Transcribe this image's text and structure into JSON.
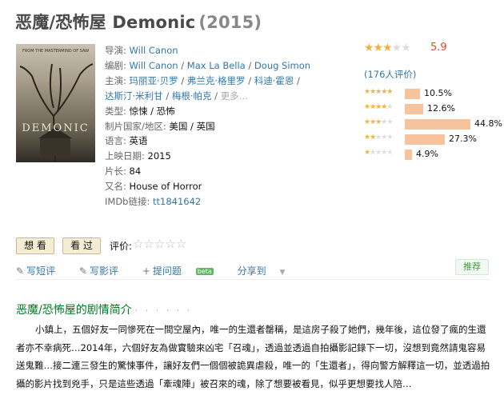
{
  "title": {
    "name": "恶魔/恐怖屋 Demonic",
    "year": "(2015)"
  },
  "poster": {
    "text": "DEMONIC",
    "tagline": "FROM THE MASTERMIND OF SAW"
  },
  "info": {
    "director_label": "导演:",
    "director": "Will Canon",
    "writer_label": "编剧:",
    "writers": [
      "Will Canon",
      "Max La Bella",
      "Doug Simon"
    ],
    "cast_label": "主演:",
    "cast": [
      "玛丽亚·贝罗",
      "弗兰克·格里罗",
      "科迪·霍恩",
      "达斯汀·米利甘",
      "梅根·帕克"
    ],
    "more": "更多...",
    "genre_label": "类型:",
    "genre": "惊悚 / 恐怖",
    "country_label": "制片国家/地区:",
    "country": "美国 / 英国",
    "language_label": "语言:",
    "language": "英语",
    "release_label": "上映日期:",
    "release": "2015",
    "runtime_label": "片长:",
    "runtime": "84",
    "aka_label": "又名:",
    "aka": "House of Horror",
    "imdb_label": "IMDb链接:",
    "imdb": "tt1841642"
  },
  "rating": {
    "score": "5.9",
    "score_value": 5.9,
    "votes": "(176人评价)",
    "distribution": [
      {
        "stars": 5,
        "percent": "10.5%",
        "value": 10.5
      },
      {
        "stars": 4,
        "percent": "12.6%",
        "value": 12.6
      },
      {
        "stars": 3,
        "percent": "44.8%",
        "value": 44.8
      },
      {
        "stars": 2,
        "percent": "27.3%",
        "value": 27.3
      },
      {
        "stars": 1,
        "percent": "4.9%",
        "value": 4.9
      }
    ]
  },
  "buttons": {
    "want": "想 看",
    "seen": "看 过",
    "rate_label": "评价:"
  },
  "actions": {
    "short_review": "写短评",
    "review": "写影评",
    "question": "提问题",
    "beta": "beta",
    "share": "分享到",
    "recommend": "推荐"
  },
  "summary": {
    "title": "恶魔/恐怖屋的剧情简介",
    "dots": "· · · · · ·",
    "text": "小鎮上，五個好友一同慘死在一間空屋內，唯一的生還者罄稱，是這房子殺了她們，幾年後，這位發了瘋的生還者亦不幸病死…2014年，六個好友為做實驗來凶宅「召魂」，透過並透過自拍攝影記錄下一切，沒想到竟然請鬼容易送鬼難…接二連三發生的驚悚事件，讓好友們一個個被詭異虐殺，唯一的「生還者」，得向警方解釋這一切，並透過拍攝的影片找到兇手，只是這些透過「牽魂陣」被召來的魂，除了想要被看見，似乎更想要找人陪…"
  },
  "colors": {
    "link": "#3377aa",
    "green": "#007722",
    "star": "#f4b13d",
    "bar": "#f7c39c",
    "score": "#e24a2a"
  }
}
